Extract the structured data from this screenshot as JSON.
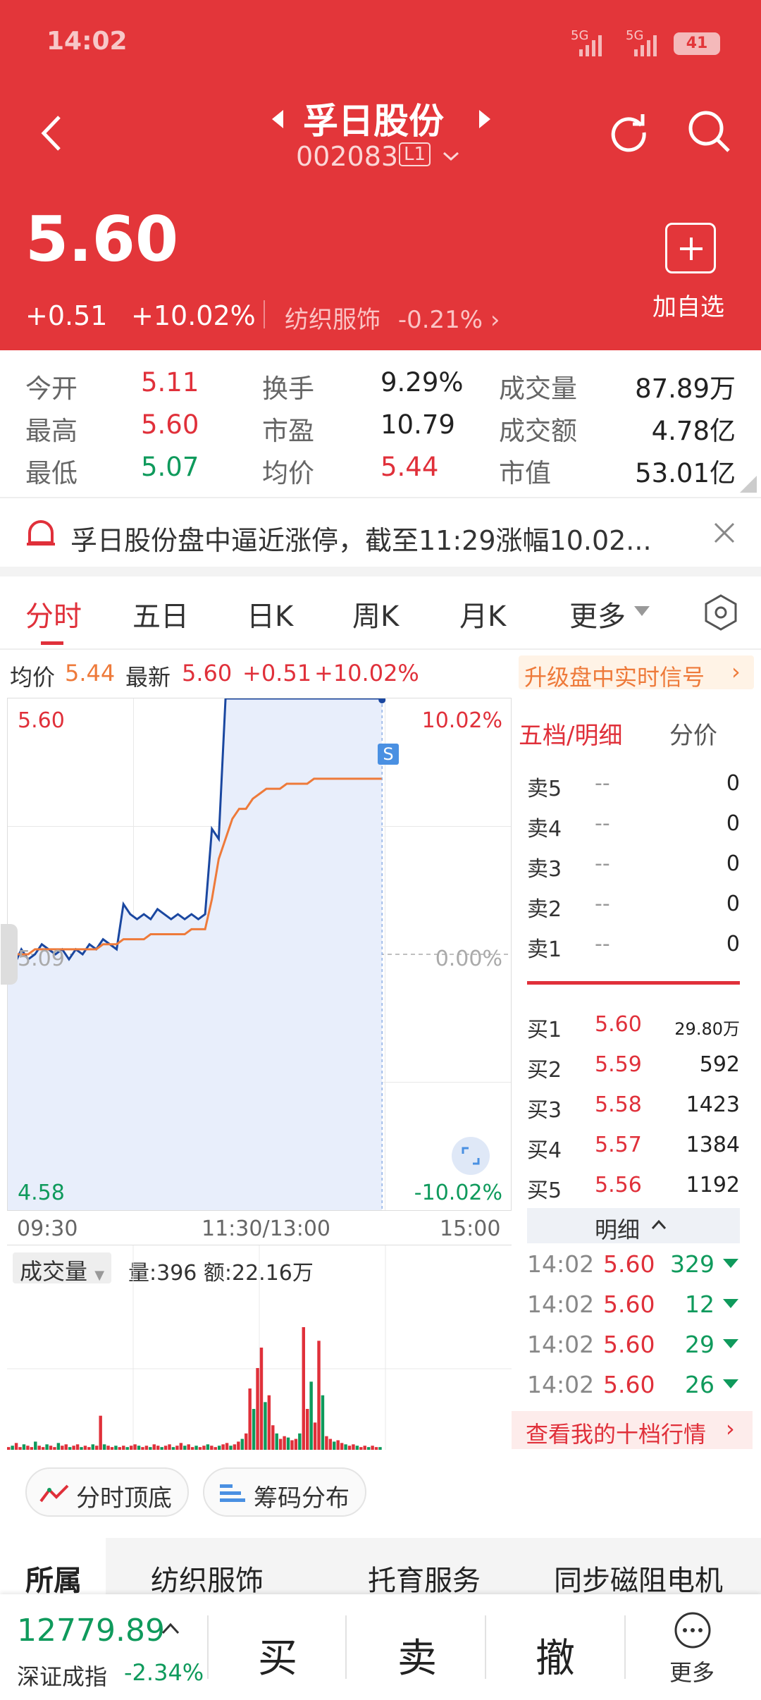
{
  "status_bar": {
    "time": "14:02",
    "signal1": "5G",
    "signal2": "5G",
    "battery": "41"
  },
  "header": {
    "stock_name": "孚日股份",
    "stock_code": "002083",
    "level": "L1",
    "price": "5.60",
    "change": "+0.51",
    "change_pct": "+10.02%",
    "sector": "纺织服饰",
    "sector_pct": "-0.21%",
    "add_watch": "加自选"
  },
  "stats": [
    {
      "label": "今开",
      "value": "5.11",
      "color": "red"
    },
    {
      "label": "换手",
      "value": "9.29%",
      "color": "black"
    },
    {
      "label": "成交量",
      "value": "87.89万",
      "color": "black"
    },
    {
      "label": "最高",
      "value": "5.60",
      "color": "red"
    },
    {
      "label": "市盈",
      "value": "10.79",
      "color": "black"
    },
    {
      "label": "成交额",
      "value": "4.78亿",
      "color": "black"
    },
    {
      "label": "最低",
      "value": "5.07",
      "color": "green"
    },
    {
      "label": "均价",
      "value": "5.44",
      "color": "red"
    },
    {
      "label": "市值",
      "value": "53.01亿",
      "color": "black"
    }
  ],
  "notice": {
    "text": "孚日股份盘中逼近涨停，截至11:29涨幅10.02..."
  },
  "tabs": [
    "分时",
    "五日",
    "日K",
    "周K",
    "月K",
    "更多"
  ],
  "chart_info": {
    "avg_label": "均价",
    "avg_value": "5.44",
    "last_label": "最新",
    "last_value": "5.60",
    "change": "+0.51",
    "change_pct": "+10.02%",
    "upgrade": "升级盘中实时信号"
  },
  "chart_data": {
    "type": "line",
    "title": "",
    "ylim": [
      4.58,
      5.6
    ],
    "y_left_labels": {
      "top": "5.60",
      "mid": "5.09",
      "bottom": "4.58"
    },
    "y_right_labels": {
      "top": "10.02%",
      "mid": "0.00%",
      "bottom": "-10.02%"
    },
    "x_labels": [
      "09:30",
      "11:30/13:00",
      "15:00"
    ],
    "series": [
      {
        "values": [
          5.09,
          5.07,
          5.1,
          5.08,
          5.09,
          5.11,
          5.1,
          5.09,
          5.1,
          5.08,
          5.1,
          5.09,
          5.11,
          5.1,
          5.12,
          5.11,
          5.1,
          5.19,
          5.17,
          5.16,
          5.17,
          5.16,
          5.18,
          5.17,
          5.16,
          5.17,
          5.16,
          5.17,
          5.16,
          5.17,
          5.34,
          5.32,
          5.6,
          5.6,
          5.6,
          5.6,
          5.6,
          5.6,
          5.6,
          5.6,
          5.6,
          5.6,
          5.6,
          5.6,
          5.6,
          5.6,
          5.6,
          5.6,
          5.6,
          5.6,
          5.6,
          5.6,
          5.6,
          5.6,
          5.6,
          5.6
        ]
      },
      {
        "values": [
          5.1,
          5.09,
          5.09,
          5.09,
          5.1,
          5.1,
          5.1,
          5.1,
          5.1,
          5.1,
          5.1,
          5.1,
          5.1,
          5.1,
          5.11,
          5.11,
          5.11,
          5.12,
          5.12,
          5.12,
          5.12,
          5.13,
          5.13,
          5.13,
          5.13,
          5.13,
          5.13,
          5.14,
          5.14,
          5.14,
          5.2,
          5.28,
          5.32,
          5.36,
          5.38,
          5.38,
          5.4,
          5.41,
          5.42,
          5.42,
          5.42,
          5.43,
          5.43,
          5.43,
          5.43,
          5.44,
          5.44,
          5.44,
          5.44,
          5.44,
          5.44,
          5.44,
          5.44,
          5.44,
          5.44,
          5.44
        ]
      }
    ],
    "volume_label": "成交量",
    "volume_info": "量:396 额:22.16万",
    "volume": [
      2,
      3,
      5,
      2,
      4,
      3,
      2,
      6,
      3,
      2,
      4,
      3,
      2,
      5,
      3,
      4,
      2,
      3,
      4,
      2,
      3,
      2,
      4,
      3,
      25,
      4,
      3,
      2,
      3,
      2,
      3,
      2,
      3,
      4,
      3,
      2,
      3,
      2,
      4,
      3,
      2,
      3,
      4,
      2,
      3,
      5,
      3,
      4,
      2,
      3,
      2,
      3,
      4,
      3,
      2,
      3,
      4,
      5,
      3,
      4,
      6,
      8,
      12,
      45,
      30,
      60,
      75,
      35,
      40,
      18,
      12,
      8,
      10,
      9,
      7,
      8,
      12,
      90,
      30,
      50,
      20,
      80,
      40,
      10,
      8,
      6,
      7,
      5,
      4,
      3,
      4,
      3,
      2,
      3,
      2,
      3,
      2,
      2
    ]
  },
  "orderbook": {
    "tab1": "五档/明细",
    "tab2": "分价",
    "sells": [
      {
        "label": "卖5",
        "price": "--",
        "vol": "0"
      },
      {
        "label": "卖4",
        "price": "--",
        "vol": "0"
      },
      {
        "label": "卖3",
        "price": "--",
        "vol": "0"
      },
      {
        "label": "卖2",
        "price": "--",
        "vol": "0"
      },
      {
        "label": "卖1",
        "price": "--",
        "vol": "0"
      }
    ],
    "buys": [
      {
        "label": "买1",
        "price": "5.60",
        "vol": "29.80万"
      },
      {
        "label": "买2",
        "price": "5.59",
        "vol": "592"
      },
      {
        "label": "买3",
        "price": "5.58",
        "vol": "1423"
      },
      {
        "label": "买4",
        "price": "5.57",
        "vol": "1384"
      },
      {
        "label": "买5",
        "price": "5.56",
        "vol": "1192"
      }
    ],
    "detail_title": "明细",
    "details": [
      {
        "time": "14:02",
        "price": "5.60",
        "vol": "329"
      },
      {
        "time": "14:02",
        "price": "5.60",
        "vol": "12"
      },
      {
        "time": "14:02",
        "price": "5.60",
        "vol": "29"
      },
      {
        "time": "14:02",
        "price": "5.60",
        "vol": "26"
      }
    ],
    "ten_level": "查看我的十档行情"
  },
  "chips": [
    {
      "label": "分时顶底"
    },
    {
      "label": "筹码分布"
    }
  ],
  "bottom_tabs": [
    "所属",
    "纺织服饰",
    "托育服务",
    "同步磁阻电机"
  ],
  "index": {
    "value": "12779.89",
    "name": "深证成指",
    "pct": "-2.34%"
  },
  "actions": {
    "buy": "买",
    "sell": "卖",
    "cancel": "撤",
    "more": "更多"
  },
  "colors": {
    "header_red": "#e3363a",
    "up_red": "#e0303a",
    "down_green": "#0f9a5c",
    "price_line": "#1a47a0",
    "avg_line": "#ee7a3a"
  }
}
